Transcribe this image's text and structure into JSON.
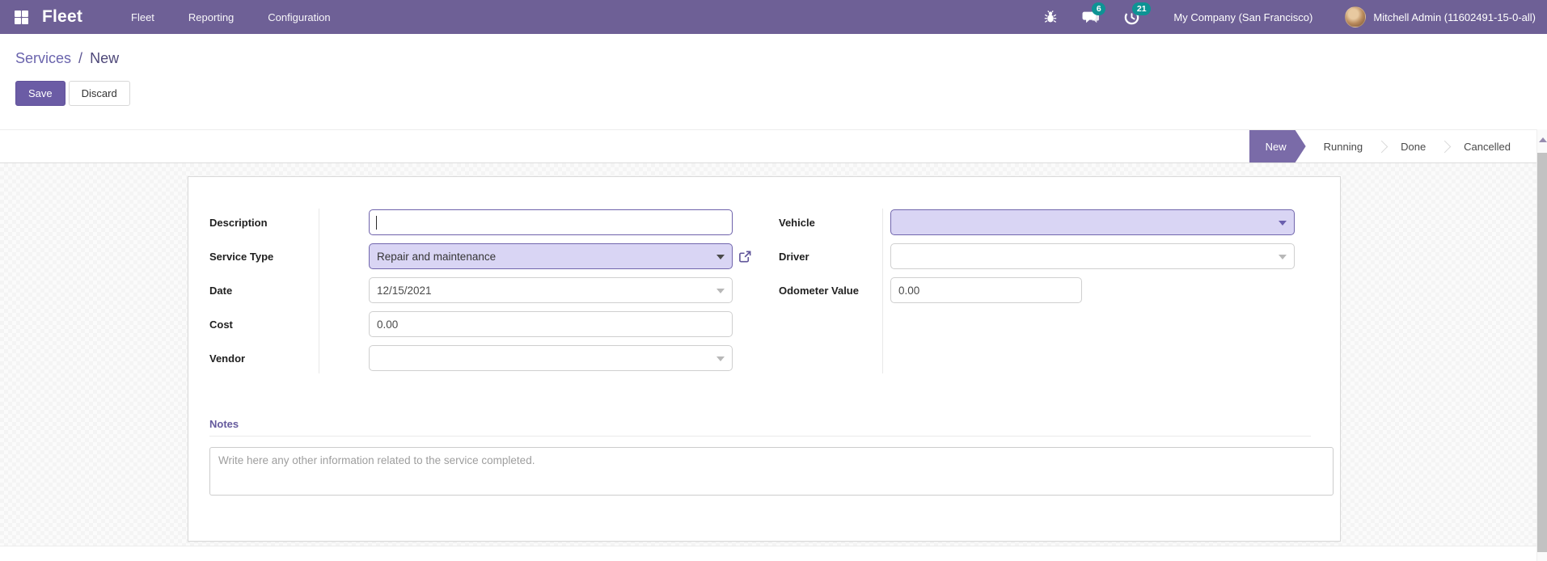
{
  "navbar": {
    "brand": "Fleet",
    "menu_items": [
      {
        "label": "Fleet"
      },
      {
        "label": "Reporting"
      },
      {
        "label": "Configuration"
      }
    ],
    "messages_count": "6",
    "activities_count": "21",
    "company_name": "My Company (San Francisco)",
    "user_name": "Mitchell Admin (11602491-15-0-all)"
  },
  "control_panel": {
    "breadcrumb_parent": "Services",
    "breadcrumb_separator": "/",
    "breadcrumb_current": "New",
    "save_label": "Save",
    "discard_label": "Discard"
  },
  "statusbar": {
    "active_stage": "New",
    "stages": [
      {
        "label": "New"
      },
      {
        "label": "Running"
      },
      {
        "label": "Done"
      },
      {
        "label": "Cancelled"
      }
    ]
  },
  "form": {
    "fields": {
      "description": {
        "label": "Description",
        "value": ""
      },
      "service_type": {
        "label": "Service Type",
        "value": "Repair and maintenance"
      },
      "date": {
        "label": "Date",
        "value": "12/15/2021"
      },
      "cost": {
        "label": "Cost",
        "value": "0.00"
      },
      "vendor": {
        "label": "Vendor",
        "value": ""
      },
      "vehicle": {
        "label": "Vehicle",
        "value": ""
      },
      "driver": {
        "label": "Driver",
        "value": ""
      },
      "odometer": {
        "label": "Odometer Value",
        "value": "0.00"
      }
    },
    "notes": {
      "heading": "Notes",
      "placeholder": "Write here any other information related to the service completed."
    }
  },
  "colors": {
    "navbar_bg": "#6e6096",
    "primary_button": "#6b5ca5",
    "active_stage_bg": "#7a6ba8",
    "required_field_bg": "#d9d5f4",
    "required_field_border": "#7166ad",
    "badge_bg": "#0d9394",
    "breadcrumb_link": "#6a64ad",
    "notes_heading": "#655a9d"
  }
}
